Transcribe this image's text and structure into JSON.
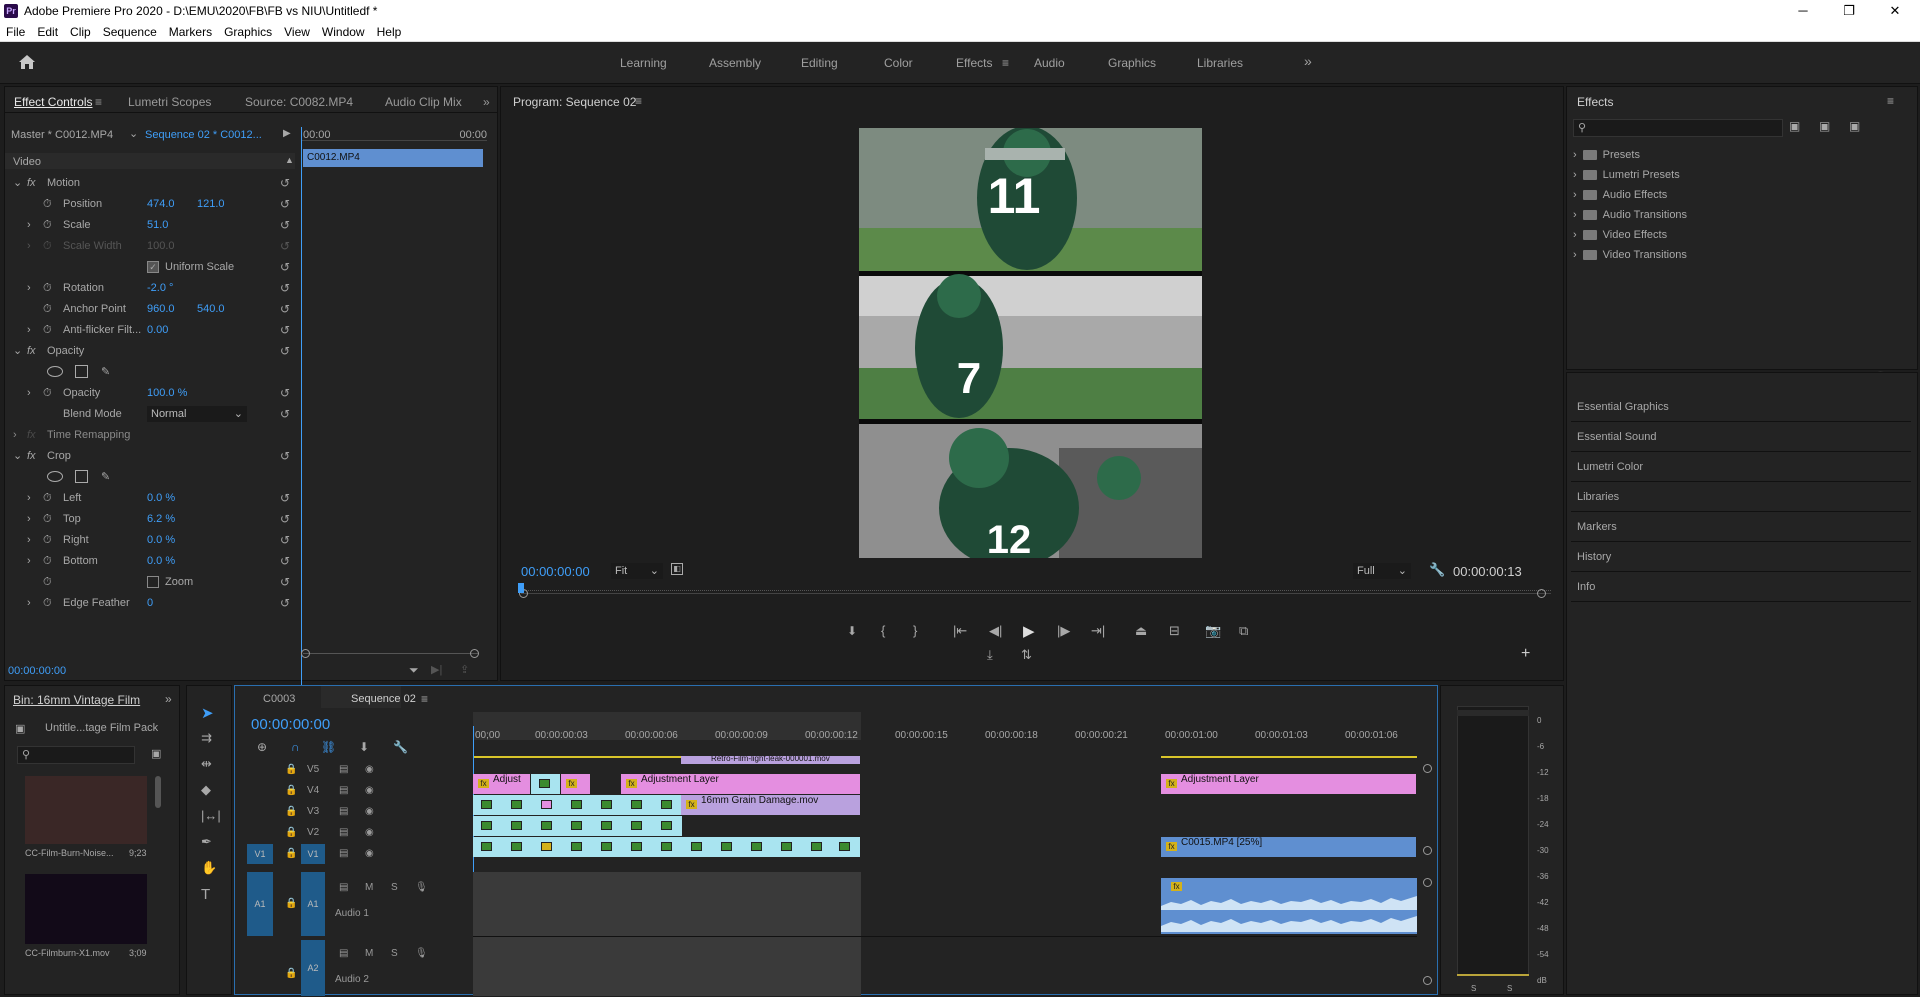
{
  "window": {
    "title": "Adobe Premiere Pro 2020 - D:\\EMU\\2020\\FB\\FB vs NIU\\Untitledf *",
    "app_badge": "Pr",
    "minimize": "─",
    "maximize": "❐",
    "close": "✕"
  },
  "menu": [
    "File",
    "Edit",
    "Clip",
    "Sequence",
    "Markers",
    "Graphics",
    "View",
    "Window",
    "Help"
  ],
  "workspaces": {
    "items": [
      "Learning",
      "Assembly",
      "Editing",
      "Color",
      "Effects",
      "Audio",
      "Graphics",
      "Libraries"
    ],
    "active": "Effects",
    "more": "»"
  },
  "left_tabs": [
    "Effect Controls",
    "Lumetri Scopes",
    "Source: C0082.MP4",
    "Audio Clip Mix"
  ],
  "effect_controls": {
    "master": "Master * C0012.MP4",
    "sequence": "Sequence 02 * C0012...",
    "tc_start": "00:00",
    "tc_end": "00:00",
    "clip_label": "C0012.MP4",
    "video_label": "Video",
    "motion": "Motion",
    "position": {
      "label": "Position",
      "x": "474.0",
      "y": "121.0"
    },
    "scale": {
      "label": "Scale",
      "value": "51.0"
    },
    "scale_width": {
      "label": "Scale Width",
      "value": "100.0"
    },
    "uniform": "Uniform Scale",
    "rotation": {
      "label": "Rotation",
      "value": "-2.0 °"
    },
    "anchor": {
      "label": "Anchor Point",
      "x": "960.0",
      "y": "540.0"
    },
    "antiflicker": {
      "label": "Anti-flicker Filt...",
      "value": "0.00"
    },
    "opacity_group": "Opacity",
    "opacity": {
      "label": "Opacity",
      "value": "100.0 %"
    },
    "blend": {
      "label": "Blend Mode",
      "value": "Normal"
    },
    "time_remap": "Time Remapping",
    "crop": "Crop",
    "left": {
      "label": "Left",
      "value": "0.0 %"
    },
    "top": {
      "label": "Top",
      "value": "6.2 %"
    },
    "right": {
      "label": "Right",
      "value": "0.0 %"
    },
    "bottom": {
      "label": "Bottom",
      "value": "0.0 %"
    },
    "zoom": "Zoom",
    "edge": {
      "label": "Edge Feather",
      "value": "0"
    },
    "current_tc": "00:00:00:00"
  },
  "program": {
    "title": "Program: Sequence 02",
    "tc": "00:00:00:00",
    "fit": "Fit",
    "full": "Full",
    "duration": "00:00:00:13",
    "jerseys": [
      "11",
      "7",
      "12"
    ]
  },
  "effects_panel": {
    "title": "Effects",
    "folders": [
      "Presets",
      "Lumetri Presets",
      "Audio Effects",
      "Audio Transitions",
      "Video Effects",
      "Video Transitions"
    ],
    "side": [
      "Essential Graphics",
      "Essential Sound",
      "Lumetri Color",
      "Libraries",
      "Markers",
      "History",
      "Info"
    ]
  },
  "bin": {
    "tab": "Bin: 16mm Vintage Film",
    "path": "Untitle...tage Film Pack",
    "items": [
      {
        "name": "CC-Film-Burn-Noise...",
        "dur": "9;23"
      },
      {
        "name": "CC-Filmburn-X1.mov",
        "dur": "3;09"
      }
    ]
  },
  "timeline": {
    "tabs": [
      "C0003",
      "Sequence 02"
    ],
    "tc": "00:00:00:00",
    "ruler": [
      "00;00",
      "00:00:00:03",
      "00:00:00:06",
      "00:00:00:09",
      "00:00:00:12",
      "00:00:00:15",
      "00:00:00:18",
      "00:00:00:21",
      "00:00:01:00",
      "00:00:01:03",
      "00:00:01:06"
    ],
    "video_tracks": [
      "V5",
      "V4",
      "V3",
      "V2",
      "V1"
    ],
    "audio_tracks": [
      {
        "id": "A1",
        "name": "Audio 1"
      },
      {
        "id": "A2",
        "name": "Audio 2"
      }
    ],
    "clips": {
      "top": "Retro-Film-light-leak-000001.mov",
      "adjust": "Adjust",
      "adj_layer": "Adjustment Layer",
      "grain": "16mm Grain Damage.mov",
      "adj_layer2": "Adjustment Layer",
      "c0015": "C0015.MP4 [25%]"
    },
    "src_v1": "V1",
    "src_a1": "A1",
    "m": "M",
    "s": "S"
  },
  "meter": {
    "labels": [
      "0",
      "-6",
      "-12",
      "-18",
      "-24",
      "-30",
      "-36",
      "-42",
      "-48",
      "-54",
      "dB"
    ],
    "s1": "S",
    "s2": "S"
  }
}
